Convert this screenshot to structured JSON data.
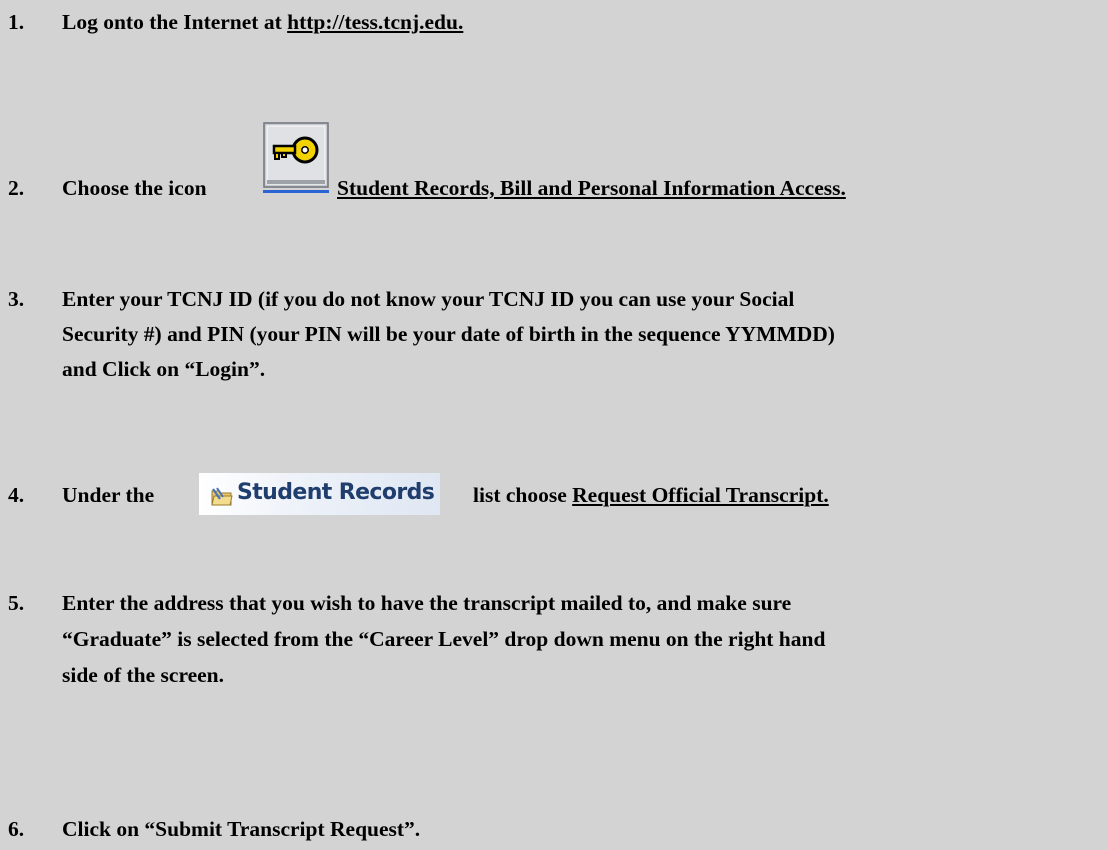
{
  "steps": [
    {
      "number": "1.",
      "text": "Log onto the Internet at ",
      "link": "http://tess.tcnj.edu."
    },
    {
      "number": "2.",
      "text_before": "Choose the icon",
      "icon": "key-icon",
      "link": "Student Records, Bill and Personal Information Access."
    },
    {
      "number": "3.",
      "lines": [
        "Enter your TCNJ ID (if you do not know your TCNJ ID you can use your Social",
        "Security #) and PIN (your PIN will be your date of birth in the sequence YYMMDD)",
        "and Click on “Login”."
      ]
    },
    {
      "number": "4.",
      "text_before": "Under the",
      "banner_text": "Student Records",
      "text_after": "list choose ",
      "link": "Request Official Transcript."
    },
    {
      "number": "5.",
      "lines": [
        "Enter the address that you wish to have the transcript mailed to, and make sure",
        "“Graduate” is selected from the “Career Level” drop down menu on the right hand",
        "side of the screen."
      ]
    },
    {
      "number": "6.",
      "text": "Click on “Submit Transcript Request”."
    }
  ]
}
